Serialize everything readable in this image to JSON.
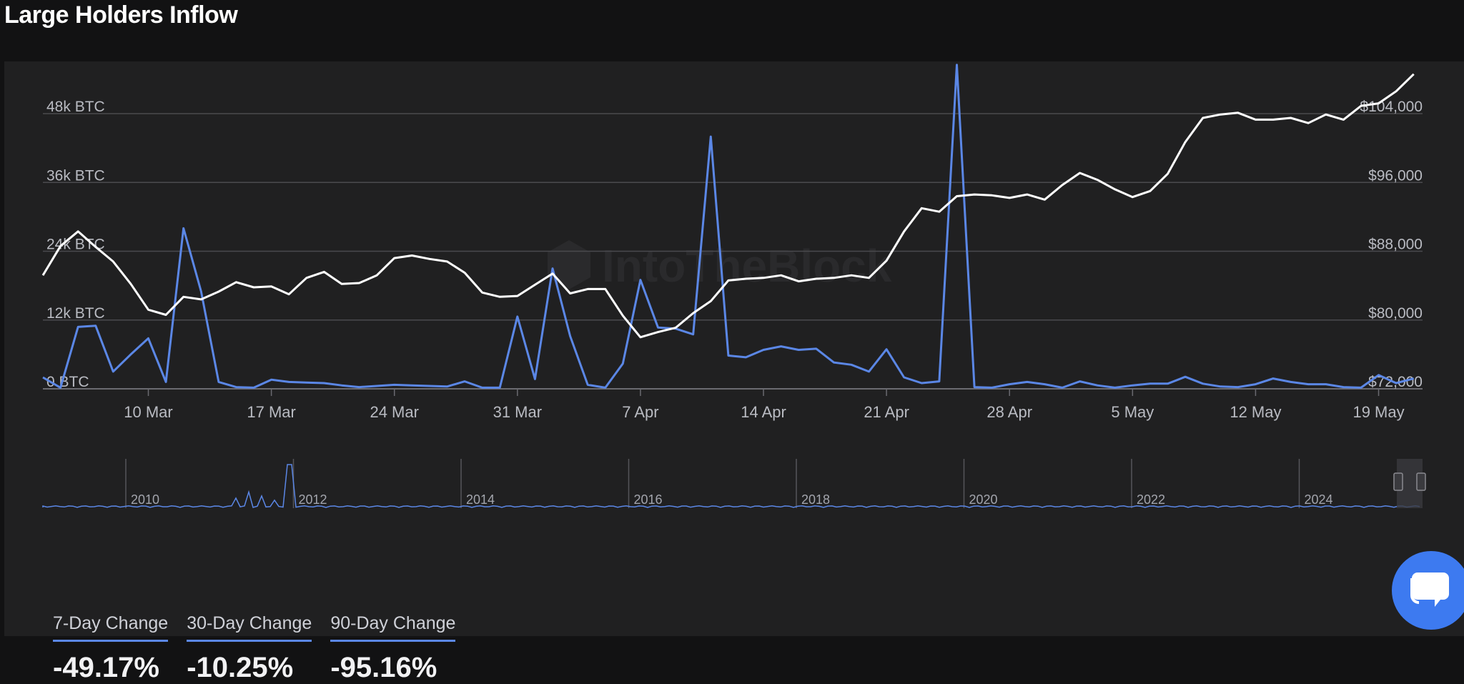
{
  "page": {
    "title": "Large Holders Inflow"
  },
  "colors": {
    "background": "#121213",
    "panel": "#202021",
    "inflow": "#5b87e6",
    "price": "#ffffff",
    "grid": "#4a4a4e",
    "accent": "#3d7af0"
  },
  "watermark": "IntoTheBlock",
  "chart_data": {
    "type": "line",
    "x_axis": {
      "tick_labels": [
        "10 Mar",
        "17 Mar",
        "24 Mar",
        "31 Mar",
        "7 Apr",
        "14 Apr",
        "21 Apr",
        "28 Apr",
        "5 May",
        "12 May",
        "19 May"
      ],
      "range_days": [
        0,
        78.5
      ],
      "tick_days": [
        6,
        13,
        20,
        27,
        34,
        41,
        48,
        55,
        62,
        69,
        76
      ]
    },
    "y_left": {
      "tick_labels": [
        "0 BTC",
        "12k BTC",
        "24k BTC",
        "36k BTC",
        "48k BTC"
      ],
      "range": [
        0,
        48000
      ]
    },
    "y_right": {
      "tick_labels": [
        "$72,000",
        "$80,000",
        "$88,000",
        "$96,000",
        "$104,000"
      ],
      "range": [
        72000,
        104000
      ]
    },
    "grid": true,
    "series": [
      {
        "axis": "left",
        "color": "#5b87e6",
        "points": [
          [
            0,
            2000
          ],
          [
            1,
            200
          ],
          [
            2,
            10800
          ],
          [
            3,
            11000
          ],
          [
            4,
            3000
          ],
          [
            5,
            6000
          ],
          [
            6,
            8800
          ],
          [
            7,
            1200
          ],
          [
            8,
            28000
          ],
          [
            9,
            17000
          ],
          [
            10,
            1200
          ],
          [
            11,
            300
          ],
          [
            12,
            200
          ],
          [
            13,
            1600
          ],
          [
            14,
            1200
          ],
          [
            15,
            1100
          ],
          [
            16,
            1000
          ],
          [
            17,
            600
          ],
          [
            18,
            300
          ],
          [
            19,
            500
          ],
          [
            20,
            700
          ],
          [
            21,
            600
          ],
          [
            22,
            500
          ],
          [
            23,
            400
          ],
          [
            24,
            1300
          ],
          [
            25,
            200
          ],
          [
            26,
            200
          ],
          [
            27,
            12600
          ],
          [
            28,
            1700
          ],
          [
            29,
            21000
          ],
          [
            30,
            9200
          ],
          [
            31,
            700
          ],
          [
            32,
            200
          ],
          [
            33,
            4400
          ],
          [
            34,
            19000
          ],
          [
            35,
            10700
          ],
          [
            36,
            10500
          ],
          [
            37,
            9500
          ],
          [
            38,
            44000
          ],
          [
            39,
            5800
          ],
          [
            40,
            5500
          ],
          [
            41,
            6800
          ],
          [
            42,
            7400
          ],
          [
            43,
            6800
          ],
          [
            44,
            7000
          ],
          [
            45,
            4600
          ],
          [
            46,
            4200
          ],
          [
            47,
            3000
          ],
          [
            48,
            6900
          ],
          [
            49,
            2000
          ],
          [
            50,
            1000
          ],
          [
            51,
            1300
          ],
          [
            52,
            56500
          ],
          [
            53,
            300
          ],
          [
            54,
            200
          ],
          [
            55,
            800
          ],
          [
            56,
            1200
          ],
          [
            57,
            800
          ],
          [
            58,
            200
          ],
          [
            59,
            1300
          ],
          [
            60,
            600
          ],
          [
            61,
            200
          ],
          [
            62,
            600
          ],
          [
            63,
            900
          ],
          [
            64,
            900
          ],
          [
            65,
            2100
          ],
          [
            66,
            900
          ],
          [
            67,
            400
          ],
          [
            68,
            300
          ],
          [
            69,
            800
          ],
          [
            70,
            1800
          ],
          [
            71,
            1200
          ],
          [
            72,
            800
          ],
          [
            73,
            800
          ],
          [
            74,
            300
          ],
          [
            75,
            200
          ],
          [
            76,
            2400
          ],
          [
            77,
            1000
          ],
          [
            78,
            1800
          ]
        ]
      },
      {
        "axis": "right",
        "color": "#ffffff",
        "points": [
          [
            0,
            85200
          ],
          [
            1,
            88600
          ],
          [
            2,
            90300
          ],
          [
            3,
            88500
          ],
          [
            4,
            86800
          ],
          [
            5,
            84200
          ],
          [
            6,
            81200
          ],
          [
            7,
            80600
          ],
          [
            8,
            82700
          ],
          [
            9,
            82400
          ],
          [
            10,
            83300
          ],
          [
            11,
            84400
          ],
          [
            12,
            83800
          ],
          [
            13,
            83900
          ],
          [
            14,
            83000
          ],
          [
            15,
            84900
          ],
          [
            16,
            85600
          ],
          [
            17,
            84200
          ],
          [
            18,
            84300
          ],
          [
            19,
            85200
          ],
          [
            20,
            87200
          ],
          [
            21,
            87500
          ],
          [
            22,
            87100
          ],
          [
            23,
            86800
          ],
          [
            24,
            85500
          ],
          [
            25,
            83200
          ],
          [
            26,
            82700
          ],
          [
            27,
            82800
          ],
          [
            28,
            84100
          ],
          [
            29,
            85400
          ],
          [
            30,
            83100
          ],
          [
            31,
            83600
          ],
          [
            32,
            83600
          ],
          [
            33,
            80500
          ],
          [
            34,
            78000
          ],
          [
            35,
            78600
          ],
          [
            36,
            79100
          ],
          [
            37,
            80800
          ],
          [
            38,
            82200
          ],
          [
            39,
            84600
          ],
          [
            40,
            84800
          ],
          [
            41,
            84900
          ],
          [
            42,
            85200
          ],
          [
            43,
            84500
          ],
          [
            44,
            84800
          ],
          [
            45,
            84900
          ],
          [
            46,
            85200
          ],
          [
            47,
            84900
          ],
          [
            48,
            86900
          ],
          [
            49,
            90300
          ],
          [
            50,
            93000
          ],
          [
            51,
            92600
          ],
          [
            52,
            94400
          ],
          [
            53,
            94600
          ],
          [
            54,
            94500
          ],
          [
            55,
            94200
          ],
          [
            56,
            94600
          ],
          [
            57,
            94000
          ],
          [
            58,
            95700
          ],
          [
            59,
            97100
          ],
          [
            60,
            96300
          ],
          [
            61,
            95200
          ],
          [
            62,
            94300
          ],
          [
            63,
            95000
          ],
          [
            64,
            97000
          ],
          [
            65,
            100700
          ],
          [
            66,
            103500
          ],
          [
            67,
            103900
          ],
          [
            68,
            104100
          ],
          [
            69,
            103300
          ],
          [
            70,
            103300
          ],
          [
            71,
            103500
          ],
          [
            72,
            102900
          ],
          [
            73,
            103900
          ],
          [
            74,
            103300
          ],
          [
            75,
            104900
          ],
          [
            76,
            105200
          ],
          [
            77,
            106600
          ],
          [
            78,
            108600
          ]
        ]
      }
    ],
    "navigator": {
      "tick_labels": [
        "2010",
        "2012",
        "2014",
        "2016",
        "2018",
        "2020",
        "2022",
        "2024"
      ]
    }
  },
  "stats": [
    {
      "label": "7-Day Change",
      "value": "-49.17%"
    },
    {
      "label": "30-Day Change",
      "value": "-10.25%"
    },
    {
      "label": "90-Day Change",
      "value": "-95.16%"
    }
  ]
}
